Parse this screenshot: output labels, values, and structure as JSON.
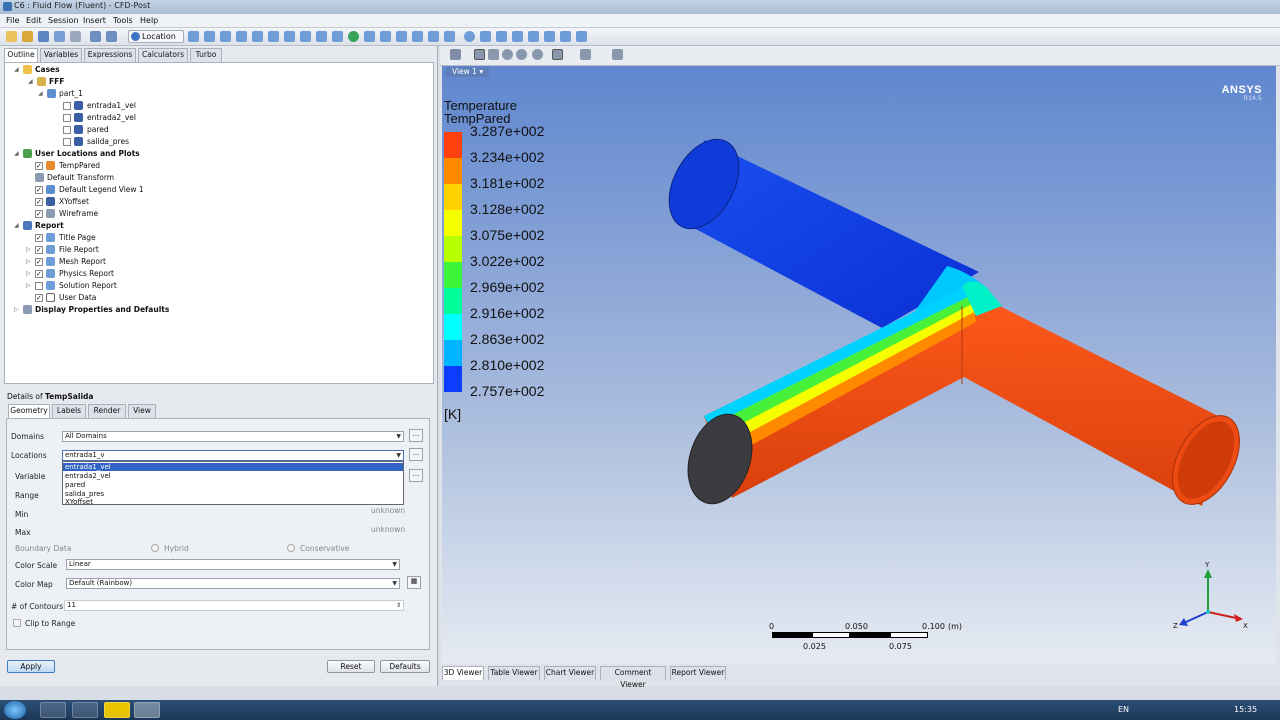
{
  "window": {
    "title": "C6 : Fluid Flow (Fluent) - CFD-Post"
  },
  "menu": [
    "File",
    "Edit",
    "Session",
    "Insert",
    "Tools",
    "Help"
  ],
  "toolbar": {
    "location_label": "Location"
  },
  "left_tabs": [
    "Outline",
    "Variables",
    "Expressions",
    "Calculators",
    "Turbo"
  ],
  "tree": {
    "cases": "Cases",
    "fff": "FFF",
    "part1": "part_1",
    "parts": [
      "entrada1_vel",
      "entrada2_vel",
      "pared",
      "salida_pres"
    ],
    "user_locations": "User Locations and Plots",
    "user_items": [
      "TempPared",
      "Default Transform",
      "Default Legend View 1",
      "XYoffset",
      "Wireframe"
    ],
    "report": "Report",
    "report_items": [
      "Title Page",
      "File Report",
      "Mesh Report",
      "Physics Report",
      "Solution Report",
      "User Data"
    ],
    "display": "Display Properties and Defaults"
  },
  "details": {
    "prefix": "Details of",
    "object": "TempSalida",
    "tabs": [
      "Geometry",
      "Labels",
      "Render",
      "View"
    ],
    "domains_label": "Domains",
    "domains_value": "All Domains",
    "locations_label": "Locations",
    "locations_value": "entrada1_v",
    "dropdown_options": [
      "entrada1_vel",
      "entrada2_vel",
      "pared",
      "salida_pres",
      "XYoffset"
    ],
    "variable_label": "Variable",
    "range_label": "Range",
    "min_label": "Min",
    "max_label": "Max",
    "min_value": "unknown",
    "max_value": "unknown",
    "boundary_label": "Boundary Data",
    "hybrid_label": "Hybrid",
    "conservative_label": "Conservative",
    "color_scale_label": "Color Scale",
    "color_scale_value": "Linear",
    "color_map_label": "Color Map",
    "color_map_value": "Default (Rainbow)",
    "contours_label": "# of Contours",
    "contours_value": "11",
    "clip_label": "Clip to Range",
    "more_button": "...",
    "apply": "Apply",
    "reset": "Reset",
    "defaults": "Defaults"
  },
  "viewer": {
    "view_label": "View 1",
    "ansys": "ANSYS",
    "ansys_version": "R14.5",
    "legend_title": "Temperature",
    "legend_subtitle": "TempPared",
    "legend_values": [
      "3.287e+002",
      "3.234e+002",
      "3.181e+002",
      "3.128e+002",
      "3.075e+002",
      "3.022e+002",
      "2.969e+002",
      "2.916e+002",
      "2.863e+002",
      "2.810e+002",
      "2.757e+002"
    ],
    "legend_colors": [
      "#ff3f0c",
      "#ff8a00",
      "#ffd100",
      "#f5ff00",
      "#b8ff00",
      "#3cf43a",
      "#00ff9a",
      "#00ffff",
      "#00b5ff",
      "#0b3cff"
    ],
    "legend_unit": "[K]",
    "scale": {
      "v0": "0",
      "v1": "0.050",
      "v2": "0.100",
      "unit": "(m)",
      "v3": "0.025",
      "v4": "0.075"
    },
    "axis": {
      "y": "Y",
      "z": "Z",
      "x": "X"
    },
    "bottom_tabs": [
      "3D Viewer",
      "Table Viewer",
      "Chart Viewer",
      "Comment Viewer",
      "Report Viewer"
    ]
  },
  "taskbar": {
    "lang": "EN",
    "time": "15:35"
  }
}
